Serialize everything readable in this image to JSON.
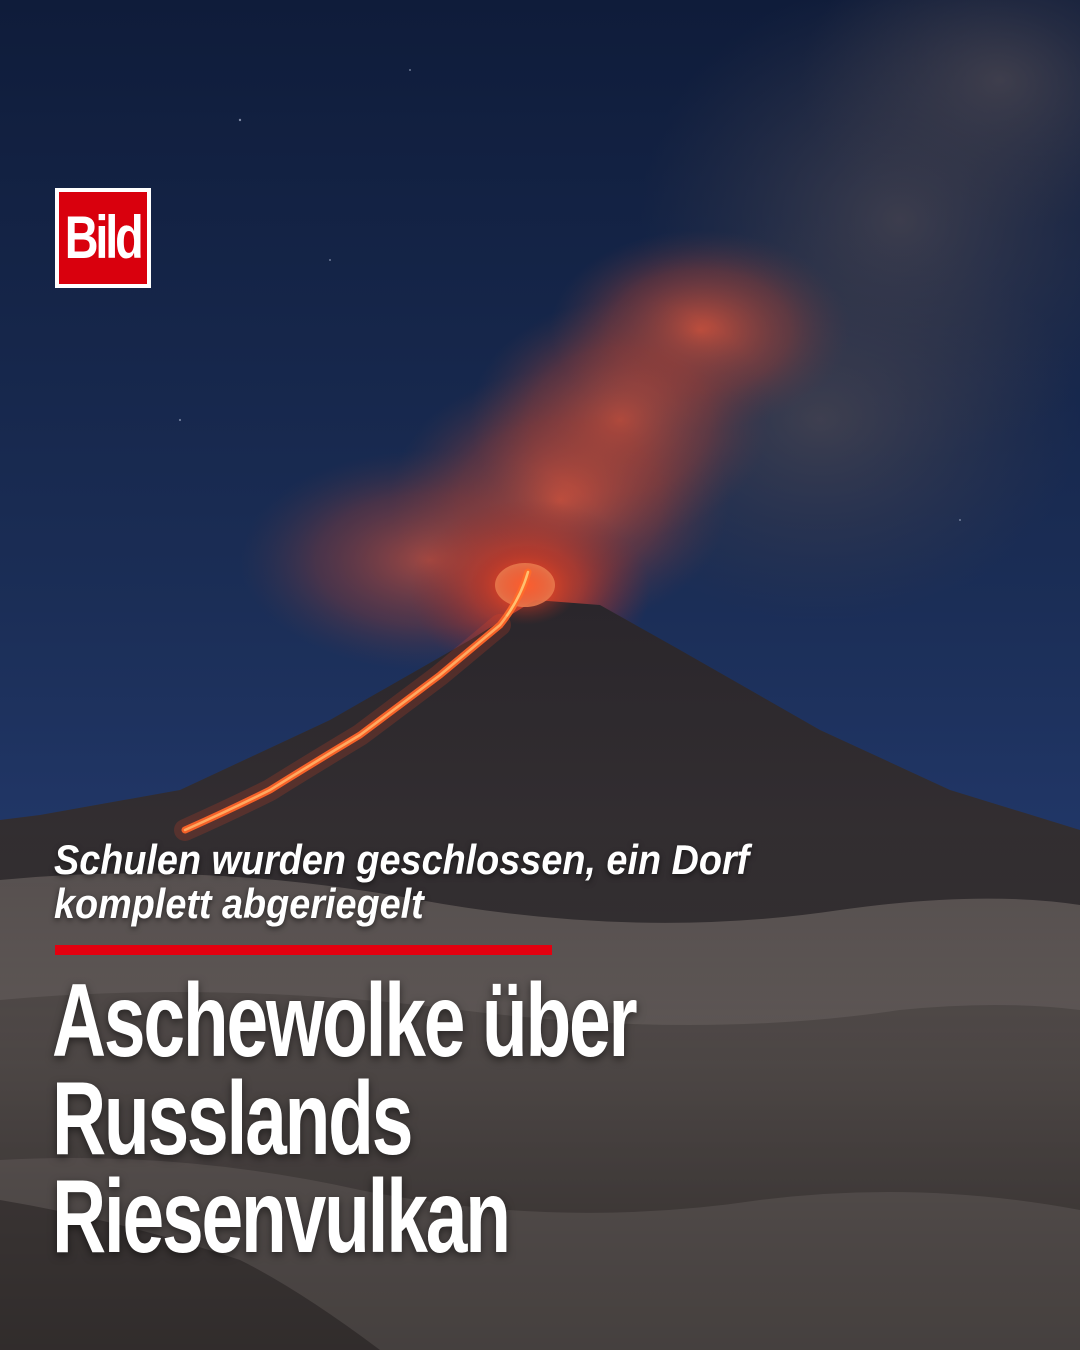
{
  "brand": {
    "logo_text": "Bild",
    "logo_color": "#d9000d"
  },
  "article": {
    "kicker": "Schulen wurden geschlossen, ein Dorf komplett abgeriegelt",
    "headline_line1": "Aschewolke über",
    "headline_line2": "Russlands Riesenvulkan",
    "accent_color": "#e3000f"
  }
}
